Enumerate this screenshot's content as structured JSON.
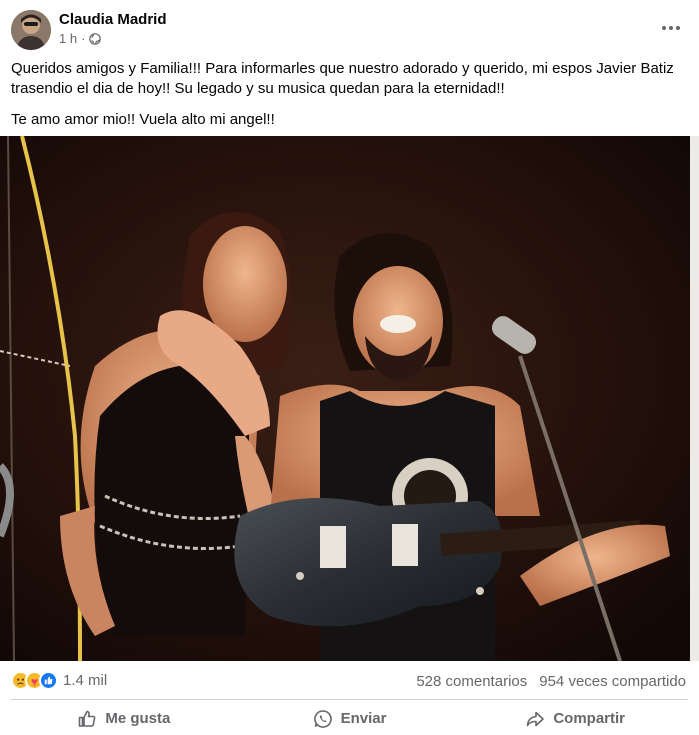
{
  "post": {
    "author": "Claudia Madrid",
    "time": "1 h",
    "separator": "·",
    "privacy_icon": "globe-icon",
    "more_icon": "more-options-icon",
    "paragraphs": [
      "Queridos amigos y Familia!!! Para informarles que nuestro adorado y querido, mi espos Javier Batiz trasendio el dia de hoy!! Su legado y su musica quedan para la eternidad!!",
      "Te amo amor mio!! Vuela alto mi angel!!"
    ]
  },
  "stats": {
    "reactions": [
      "sad-reaction",
      "care-reaction",
      "like-reaction"
    ],
    "reaction_count": "1.4 mil",
    "comments": "528 comentarios",
    "shares": "954 veces compartido"
  },
  "actions": {
    "like": "Me gusta",
    "send": "Enviar",
    "share": "Compartir"
  },
  "colors": {
    "secondary_text": "#65676b",
    "divider": "#ced0d4",
    "like_blue": "#1877f2",
    "sad_yellow": "#f7b928",
    "care_red": "#f33e58"
  }
}
